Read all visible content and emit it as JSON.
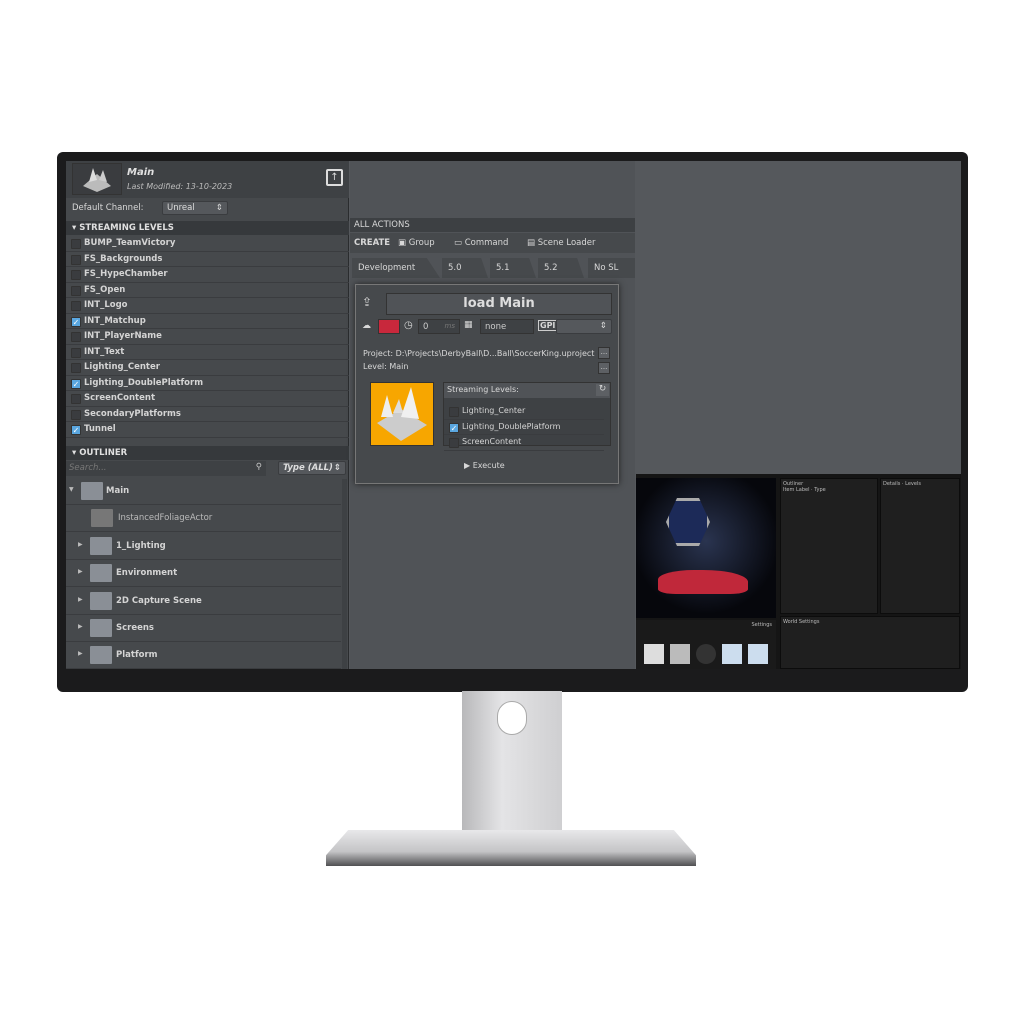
{
  "header": {
    "title": "Main",
    "last_modified": "Last Modified: 13-10-2023"
  },
  "channel": {
    "label": "Default Channel:",
    "value": "Unreal"
  },
  "streaming": {
    "heading": "STREAMING LEVELS",
    "items": [
      {
        "label": "BUMP_TeamVictory",
        "checked": false
      },
      {
        "label": "FS_Backgrounds",
        "checked": false
      },
      {
        "label": "FS_HypeChamber",
        "checked": false
      },
      {
        "label": "FS_Open",
        "checked": false
      },
      {
        "label": "INT_Logo",
        "checked": false
      },
      {
        "label": "INT_Matchup",
        "checked": true
      },
      {
        "label": "INT_PlayerName",
        "checked": false
      },
      {
        "label": "INT_Text",
        "checked": false
      },
      {
        "label": "Lighting_Center",
        "checked": false
      },
      {
        "label": "Lighting_DoublePlatform",
        "checked": true
      },
      {
        "label": "ScreenContent",
        "checked": false
      },
      {
        "label": "SecondaryPlatforms",
        "checked": false
      },
      {
        "label": "Tunnel",
        "checked": true
      }
    ]
  },
  "outliner": {
    "heading": "OUTLINER",
    "search_placeholder": "Search...",
    "type_filter": "Type (ALL)",
    "items": [
      "Main",
      "InstancedFoliageActor",
      "1_Lighting",
      "Environment",
      "2D Capture Scene",
      "Screens",
      "Platform"
    ]
  },
  "actions": {
    "heading": "ALL ACTIONS",
    "create": "CREATE",
    "buttons": [
      "Group",
      "Command",
      "Scene Loader"
    ],
    "tabs": [
      "Development",
      "5.0",
      "5.1",
      "5.2",
      "No SL"
    ]
  },
  "popup": {
    "title": "load Main",
    "color": "#c8283c",
    "delay": "0",
    "delay_unit": "ms",
    "tc": "none",
    "gpi_label": "GPI",
    "project_label": "Project:",
    "project": "D:\\Projects\\DerbyBall\\D...Ball\\SoccerKing.uproject",
    "level_label": "Level:",
    "level": "Main",
    "streaming_label": "Streaming Levels:",
    "streaming_items": [
      {
        "label": "Lighting_Center",
        "checked": false
      },
      {
        "label": "Lighting_DoublePlatform",
        "checked": true
      },
      {
        "label": "ScreenContent",
        "checked": false
      }
    ],
    "execute": "Execute"
  },
  "unreal": {
    "outliner": "Outliner",
    "details": "Details",
    "levels": "Levels",
    "world_settings": "World Settings",
    "settings": "Settings",
    "item_label": "Item Label",
    "type": "Type"
  }
}
